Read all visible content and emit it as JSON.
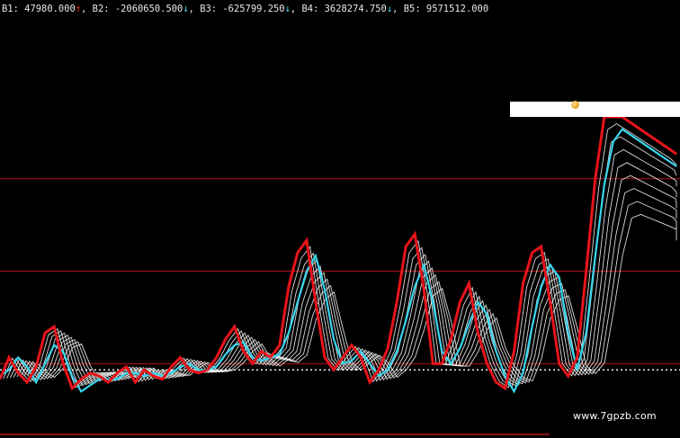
{
  "readout": {
    "b1": "B1: 47980.000",
    "b1_arrow": "↑",
    "b2": ", B2: -2060650.500",
    "b2_arrow": "↓",
    "b3": ", B3: -625799.250",
    "b3_arrow": "↓",
    "b4": ", B4: 3628274.750",
    "b4_arrow": "↓",
    "b5": ", B5: 9571512.000"
  },
  "watermark": "www.7gpzb.com",
  "colors": {
    "background": "#000000",
    "red_line": "#e8141a",
    "cyan_line": "#36d6ee",
    "white_line": "#f2f2f2",
    "band_line": "#8a0f14"
  },
  "chart_data": {
    "type": "line",
    "title": "",
    "xlabel": "",
    "ylabel": "",
    "ylim": [
      0,
      100
    ],
    "reference_levels": [
      20,
      50,
      80
    ],
    "dotted_baseline": 18,
    "x": [
      0,
      1,
      2,
      3,
      4,
      5,
      6,
      7,
      8,
      9,
      10,
      11,
      12,
      13,
      14,
      15,
      16,
      17,
      18,
      19,
      20,
      21,
      22,
      23,
      24,
      25,
      26,
      27,
      28,
      29,
      30,
      31,
      32,
      33,
      34,
      35,
      36,
      37,
      38,
      39,
      40,
      41,
      42,
      43,
      44,
      45,
      46,
      47,
      48,
      49,
      50,
      51,
      52,
      53,
      54,
      55,
      56,
      57,
      58,
      59,
      60,
      61,
      62,
      63,
      64,
      65,
      66,
      67,
      68,
      69,
      70,
      71,
      72,
      73,
      74,
      75
    ],
    "series": [
      {
        "name": "",
        "color": "#e8141a",
        "values": [
          15,
          22,
          17,
          14,
          19,
          30,
          32,
          20,
          12,
          15,
          17,
          16,
          14,
          17,
          19,
          14,
          18,
          16,
          15,
          19,
          22,
          18,
          17,
          18,
          22,
          28,
          32,
          24,
          20,
          24,
          22,
          26,
          45,
          56,
          60,
          40,
          22,
          18,
          22,
          26,
          22,
          14,
          18,
          25,
          40,
          58,
          62,
          44,
          20,
          20,
          28,
          40,
          46,
          30,
          20,
          14,
          12,
          24,
          46,
          56,
          58,
          40,
          20,
          16,
          22,
          50,
          80,
          100,
          102,
          100,
          98,
          96,
          94,
          92,
          90,
          88
        ]
      },
      {
        "name": "",
        "color": "#36d6ee",
        "values": [
          16,
          18,
          22,
          19,
          14,
          20,
          26,
          24,
          16,
          11,
          13,
          15,
          15,
          15,
          17,
          17,
          16,
          17,
          16,
          17,
          19,
          20,
          18,
          18,
          19,
          23,
          26,
          27,
          22,
          21,
          22,
          23,
          30,
          40,
          50,
          55,
          44,
          28,
          20,
          21,
          24,
          20,
          16,
          18,
          24,
          34,
          45,
          52,
          40,
          24,
          20,
          25,
          33,
          40,
          36,
          24,
          16,
          11,
          17,
          32,
          45,
          52,
          48,
          30,
          18,
          30,
          55,
          78,
          92,
          96,
          94,
          92,
          90,
          88,
          86,
          84
        ]
      }
    ]
  }
}
